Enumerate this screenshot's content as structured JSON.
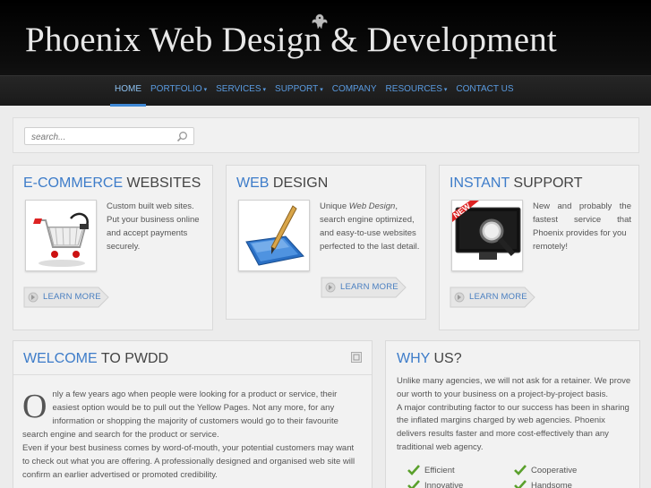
{
  "site": {
    "title": "Phoenix Web Design & Development"
  },
  "nav": {
    "items": [
      {
        "label": "HOME",
        "active": true,
        "dropdown": false
      },
      {
        "label": "PORTFOLIO",
        "active": false,
        "dropdown": true
      },
      {
        "label": "SERVICES",
        "active": false,
        "dropdown": true
      },
      {
        "label": "SUPPORT",
        "active": false,
        "dropdown": true
      },
      {
        "label": "COMPANY",
        "active": false,
        "dropdown": false
      },
      {
        "label": "RESOURCES",
        "active": false,
        "dropdown": true
      },
      {
        "label": "CONTACT US",
        "active": false,
        "dropdown": false
      }
    ]
  },
  "search": {
    "placeholder": "search..."
  },
  "features": [
    {
      "highlight": "E-COMMERCE",
      "rest": " WEBSITES",
      "text": [
        "Custom built web sites.",
        "Put your business online",
        "and accept payments",
        "securely."
      ],
      "button": "LEARN MORE",
      "icon": "shopping-cart-icon"
    },
    {
      "highlight": "WEB",
      "rest": " DESIGN",
      "text_prefix": "Unique ",
      "text_em": "Web Design",
      "text_suffix": ",",
      "text": [
        "search engine optimized,",
        "and easy-to-use websites",
        "perfected to the last detail."
      ],
      "button": "LEARN MORE",
      "icon": "pen-tablet-icon"
    },
    {
      "highlight": "INSTANT",
      "rest": " SUPPORT",
      "text": [
        "New and probably the",
        "fastest service that",
        "Phoenix provides for you",
        "remotely!"
      ],
      "button": "LEARN MORE",
      "icon": "monitor-magnifier-icon",
      "badge": "NEW"
    }
  ],
  "welcome": {
    "highlight": "WELCOME",
    "rest": " TO PWDD",
    "dropcap": "O",
    "p1": "nly a few years ago when people were looking for a product or service, their easiest option would be to pull out the Yellow Pages. Not any more, for any information or shopping the majority of customers would go to their favourite search engine and search for the product or service.",
    "p2": "Even if your best business comes by word-of-mouth, your potential customers may want to check out what you are offering. A professionally designed and organised web site will confirm an earlier advertised or promoted credibility."
  },
  "why": {
    "highlight": "WHY",
    "rest": " US?",
    "p1": "Unlike many agencies, we will not ask for a retainer. We prove our worth to your business on a project-by-project basis.",
    "p2": "A major contributing factor to our success has been in sharing the inflated margins charged by web agencies. Phoenix delivers results faster and more cost-effectively than any traditional web agency.",
    "checks": [
      "Efficient",
      "Cooperative",
      "Innovative",
      "Handsome"
    ]
  },
  "colors": {
    "accent": "#3d7cc9",
    "nav_link": "#5a9be0",
    "check": "#5aa02c"
  }
}
